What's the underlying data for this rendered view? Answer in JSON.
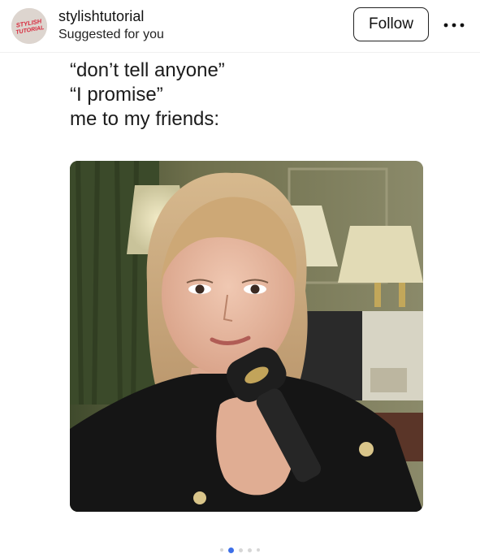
{
  "header": {
    "username": "stylishtutorial",
    "subtitle": "Suggested for you",
    "follow_label": "Follow",
    "more_icon": "more-horizontal-icon",
    "avatar_text_line1": "STYLISH",
    "avatar_text_line2": "TUTORIAL"
  },
  "post": {
    "caption_lines": [
      "“don’t tell anyone”",
      "“I promise”",
      "me to my friends:"
    ]
  },
  "carousel": {
    "total": 5,
    "active_index": 1
  },
  "colors": {
    "accent": "#3d6fe8",
    "text": "#111111",
    "avatar_logo": "#d8263a"
  }
}
